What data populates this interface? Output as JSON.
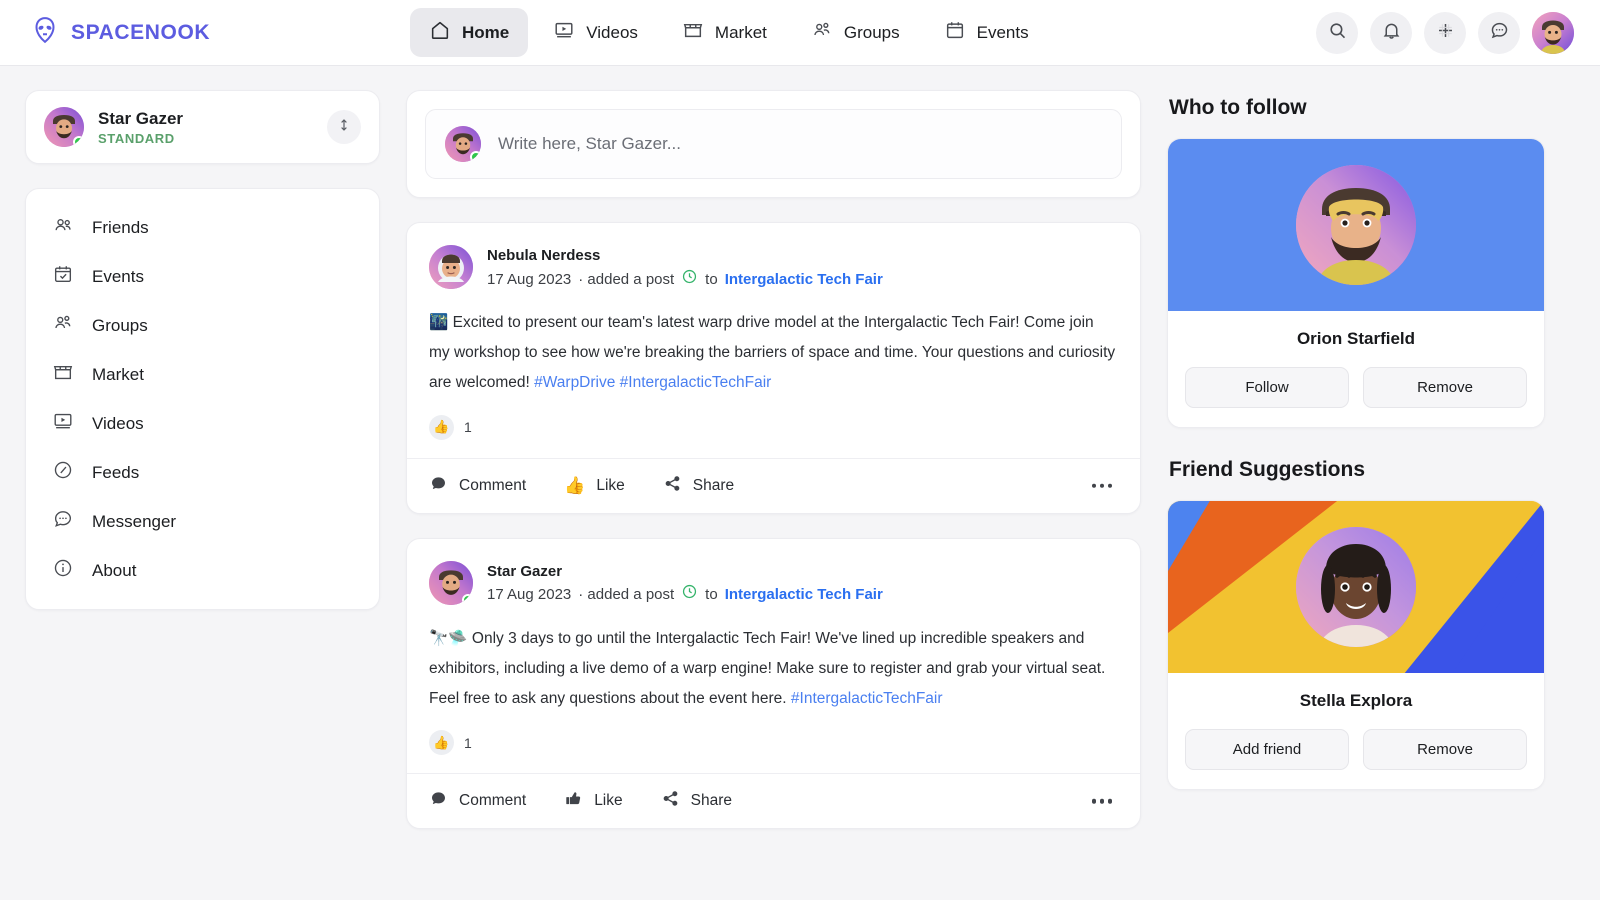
{
  "brand": {
    "name": "SPACENOOK",
    "logo_icon": "alien-head-icon",
    "color": "#5c5ce0"
  },
  "nav": {
    "items": [
      {
        "label": "Home",
        "icon": "home-icon",
        "active": true
      },
      {
        "label": "Videos",
        "icon": "video-icon",
        "active": false
      },
      {
        "label": "Market",
        "icon": "store-icon",
        "active": false
      },
      {
        "label": "Groups",
        "icon": "groups-icon",
        "active": false
      },
      {
        "label": "Events",
        "icon": "calendar-icon",
        "active": false
      }
    ]
  },
  "header_actions": {
    "search_icon": "search-icon",
    "notifications_icon": "bell-icon",
    "create_icon": "plus-grid-icon",
    "messenger_icon": "chat-dots-icon",
    "avatar": "user-avatar"
  },
  "sidebar": {
    "profile": {
      "name": "Star Gazer",
      "plan": "STANDARD",
      "plan_color": "#5aa06b",
      "status": "online",
      "swap_icon": "up-down-arrow-icon"
    },
    "menu": [
      {
        "label": "Friends",
        "icon": "friends-icon"
      },
      {
        "label": "Events",
        "icon": "calendar-check-icon"
      },
      {
        "label": "Groups",
        "icon": "groups-icon"
      },
      {
        "label": "Market",
        "icon": "store-icon"
      },
      {
        "label": "Videos",
        "icon": "video-icon"
      },
      {
        "label": "Feeds",
        "icon": "compass-icon"
      },
      {
        "label": "Messenger",
        "icon": "chat-dots-icon"
      },
      {
        "label": "About",
        "icon": "info-icon"
      }
    ]
  },
  "composer": {
    "placeholder": "Write here, Star Gazer...",
    "avatar": "user-avatar"
  },
  "feed": {
    "posts": [
      {
        "author": "Nebula Nerdess",
        "date": "17 Aug 2023",
        "action": "· added a post",
        "clock_icon": "clock-icon",
        "to_label": "to",
        "group": "Intergalactic Tech Fair",
        "emoji": "🌃",
        "text": "Excited to present our team's latest warp drive model at the Intergalactic Tech Fair! Come join my workshop to see how we're breaking the barriers of space and time. Your questions and curiosity are welcomed! ",
        "hashtags": [
          "#WarpDrive",
          "#IntergalacticTechFair"
        ],
        "reaction_emoji": "👍",
        "reaction_count": "1",
        "liked": true,
        "actions": {
          "comment": "Comment",
          "like": "Like",
          "share": "Share"
        }
      },
      {
        "author": "Star Gazer",
        "date": "17 Aug 2023",
        "action": "· added a post",
        "clock_icon": "clock-icon",
        "to_label": "to",
        "group": "Intergalactic Tech Fair",
        "emoji": "🔭🛸",
        "text": "Only 3 days to go until the Intergalactic Tech Fair! We've lined up incredible speakers and exhibitors, including a live demo of a warp engine! Make sure to register and grab your virtual seat. Feel free to ask any questions about the event here. ",
        "hashtags": [
          "#IntergalacticTechFair"
        ],
        "reaction_emoji": "👍",
        "reaction_count": "1",
        "liked": false,
        "actions": {
          "comment": "Comment",
          "like": "Like",
          "share": "Share"
        }
      }
    ]
  },
  "right": {
    "who_to_follow": {
      "title": "Who to follow",
      "person": "Orion Starfield",
      "primary_button": "Follow",
      "secondary_button": "Remove",
      "cover_color": "#5b8cf0"
    },
    "friend_suggestions": {
      "title": "Friend Suggestions",
      "person": "Stella Explora",
      "primary_button": "Add friend",
      "secondary_button": "Remove",
      "cover_colors": [
        "#4d83ef",
        "#e8641e",
        "#f2c230",
        "#3a53e8"
      ]
    }
  }
}
